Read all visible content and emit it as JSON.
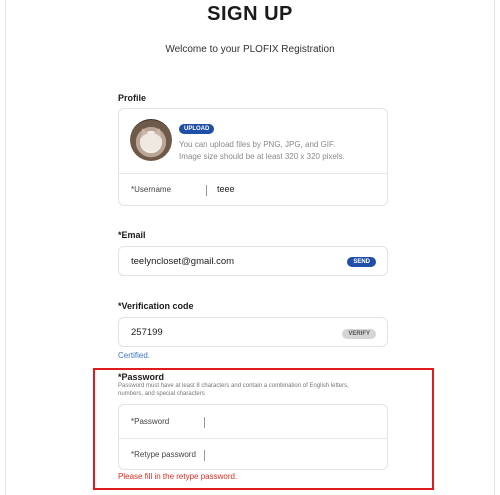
{
  "header": {
    "title": "SIGN UP",
    "subtitle": "Welcome to your PLOFIX Registration"
  },
  "profile": {
    "label": "Profile",
    "upload_label": "UPLOAD",
    "upload_note_line1": "You can upload files by PNG, JPG, and GIF.",
    "upload_note_line2": "Image size should be at least 320 x 320 pixels.",
    "username_label": "*Username",
    "username_value": "teee"
  },
  "email": {
    "label": "*Email",
    "value": "teelyncloset@gmail.com",
    "send_label": "SEND"
  },
  "verification": {
    "label": "*Verification code",
    "value": "257199",
    "verify_label": "VERIFY",
    "status": "Certified."
  },
  "password": {
    "label": "*Password",
    "hint_line1": "Password must have at least 8 characters and contain a combination of English letters,",
    "hint_line2": "numbers, and special characters",
    "password_label": "*Password",
    "retype_label": "*Retype password",
    "error": "Please fill in the retype password."
  },
  "colors": {
    "accent": "#1f4fa8",
    "error": "#e01b1b",
    "certified": "#3b73c9"
  }
}
